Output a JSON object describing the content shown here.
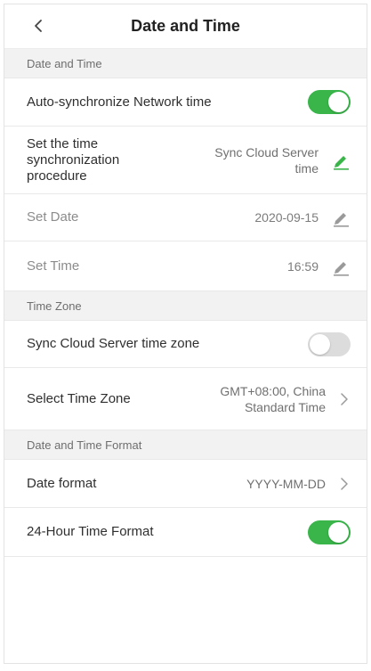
{
  "header": {
    "title": "Date and Time"
  },
  "colors": {
    "accent": "#39b54a",
    "toggle_off": "#dcdcdc",
    "section_bg": "#f2f2f2"
  },
  "sections": {
    "date_time": {
      "heading": "Date and Time",
      "auto_sync": {
        "label": "Auto-synchronize Network time",
        "state": "on"
      },
      "sync_procedure": {
        "label": "Set the time synchronization procedure",
        "value": "Sync Cloud Server time",
        "icon": "edit-icon"
      },
      "set_date": {
        "label": "Set Date",
        "value": "2020-09-15",
        "icon": "edit-icon"
      },
      "set_time": {
        "label": "Set Time",
        "value": "16:59",
        "icon": "edit-icon"
      }
    },
    "time_zone": {
      "heading": "Time Zone",
      "sync_zone": {
        "label": "Sync Cloud Server time zone",
        "state": "off"
      },
      "select_zone": {
        "label": "Select Time Zone",
        "value": "GMT+08:00, China Standard Time",
        "icon": "chevron-right-icon"
      }
    },
    "format": {
      "heading": "Date and Time Format",
      "date_format": {
        "label": "Date format",
        "value": "YYYY-MM-DD",
        "icon": "chevron-right-icon"
      },
      "hour24": {
        "label": "24-Hour Time Format",
        "state": "on"
      }
    }
  }
}
